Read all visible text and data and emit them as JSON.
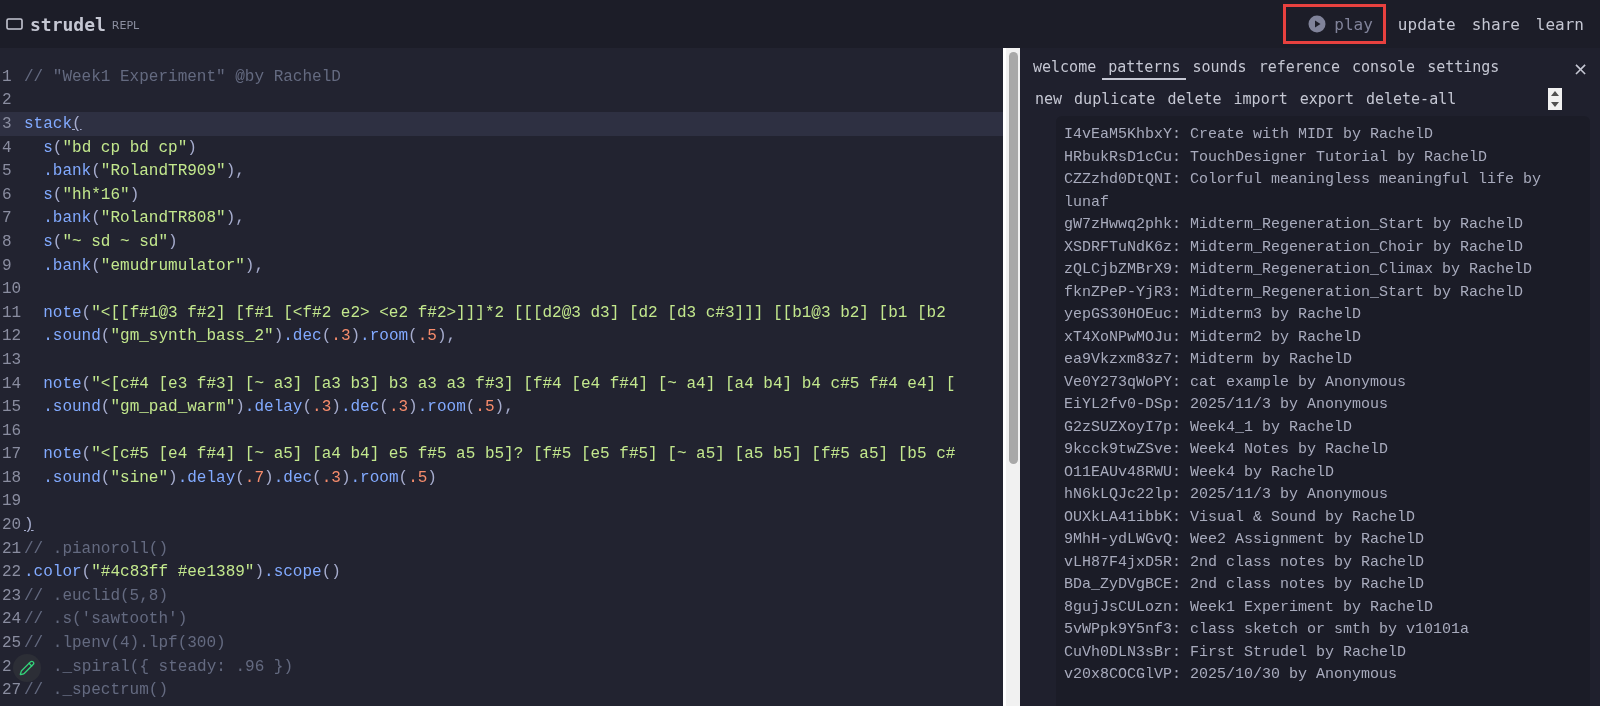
{
  "header": {
    "logo": "strudel",
    "subtitle": "REPL",
    "actions": [
      {
        "kind": "play",
        "label": "play",
        "highlighted": true
      },
      {
        "kind": "text",
        "label": "update",
        "highlighted": false
      },
      {
        "kind": "text",
        "label": "share",
        "highlighted": false
      },
      {
        "kind": "text",
        "label": "learn",
        "highlighted": false
      }
    ]
  },
  "editor": {
    "lines": [
      {
        "number": "1",
        "active": false,
        "tokens": [
          {
            "kind": "comment",
            "text": "// \"Week1 Experiment\" @by RachelD"
          }
        ]
      },
      {
        "number": "2",
        "active": false
      },
      {
        "number": "3",
        "active": true,
        "tokens": [
          {
            "kind": "func",
            "text": "stack"
          },
          {
            "kind": "match",
            "text": "("
          }
        ]
      },
      {
        "number": "4",
        "active": false,
        "tokens": [
          {
            "kind": "func",
            "text": "  s"
          },
          {
            "kind": "punct",
            "text": "("
          },
          {
            "kind": "string",
            "text": "\"bd cp bd cp\""
          },
          {
            "kind": "punct",
            "text": ")"
          }
        ]
      },
      {
        "number": "5",
        "active": false,
        "tokens": [
          {
            "kind": "func",
            "text": "  .bank"
          },
          {
            "kind": "punct",
            "text": "("
          },
          {
            "kind": "string",
            "text": "\"RolandTR909\""
          },
          {
            "kind": "punct",
            "text": "),"
          }
        ]
      },
      {
        "number": "6",
        "active": false,
        "tokens": [
          {
            "kind": "func",
            "text": "  s"
          },
          {
            "kind": "punct",
            "text": "("
          },
          {
            "kind": "string",
            "text": "\"hh*16\""
          },
          {
            "kind": "punct",
            "text": ")"
          }
        ]
      },
      {
        "number": "7",
        "active": false,
        "tokens": [
          {
            "kind": "func",
            "text": "  .bank"
          },
          {
            "kind": "punct",
            "text": "("
          },
          {
            "kind": "string",
            "text": "\"RolandTR808\""
          },
          {
            "kind": "punct",
            "text": "),"
          }
        ]
      },
      {
        "number": "8",
        "active": false,
        "tokens": [
          {
            "kind": "func",
            "text": "  s"
          },
          {
            "kind": "punct",
            "text": "("
          },
          {
            "kind": "string",
            "text": "\"~ sd ~ sd\""
          },
          {
            "kind": "punct",
            "text": ")"
          }
        ]
      },
      {
        "number": "9",
        "active": false,
        "tokens": [
          {
            "kind": "func",
            "text": "  .bank"
          },
          {
            "kind": "punct",
            "text": "("
          },
          {
            "kind": "string",
            "text": "\"emudrumulator\""
          },
          {
            "kind": "punct",
            "text": "),"
          }
        ]
      },
      {
        "number": "10",
        "active": false
      },
      {
        "number": "11",
        "active": false,
        "tokens": [
          {
            "kind": "func",
            "text": "  note"
          },
          {
            "kind": "punct",
            "text": "("
          },
          {
            "kind": "string",
            "text": "\"<[[f#1@3 f#2] [f#1 [<f#2 e2> <e2 f#2>]]]*2 [[[d2@3 d3] [d2 [d3 c#3]]] [[b1@3 b2] [b1 [b2"
          }
        ]
      },
      {
        "number": "12",
        "active": false,
        "tokens": [
          {
            "kind": "func",
            "text": "  .sound"
          },
          {
            "kind": "punct",
            "text": "("
          },
          {
            "kind": "string",
            "text": "\"gm_synth_bass_2\""
          },
          {
            "kind": "punct",
            "text": ")"
          },
          {
            "kind": "func",
            "text": ".dec"
          },
          {
            "kind": "punct",
            "text": "("
          },
          {
            "kind": "number",
            "text": ".3"
          },
          {
            "kind": "punct",
            "text": ")"
          },
          {
            "kind": "func",
            "text": ".room"
          },
          {
            "kind": "punct",
            "text": "("
          },
          {
            "kind": "number",
            "text": ".5"
          },
          {
            "kind": "punct",
            "text": "),"
          }
        ]
      },
      {
        "number": "13",
        "active": false
      },
      {
        "number": "14",
        "active": false,
        "tokens": [
          {
            "kind": "func",
            "text": "  note"
          },
          {
            "kind": "punct",
            "text": "("
          },
          {
            "kind": "string",
            "text": "\"<[c#4 [e3 f#3] [~ a3] [a3 b3] b3 a3 a3 f#3] [f#4 [e4 f#4] [~ a4] [a4 b4] b4 c#5 f#4 e4] ["
          }
        ]
      },
      {
        "number": "15",
        "active": false,
        "tokens": [
          {
            "kind": "func",
            "text": "  .sound"
          },
          {
            "kind": "punct",
            "text": "("
          },
          {
            "kind": "string",
            "text": "\"gm_pad_warm\""
          },
          {
            "kind": "punct",
            "text": ")"
          },
          {
            "kind": "func",
            "text": ".delay"
          },
          {
            "kind": "punct",
            "text": "("
          },
          {
            "kind": "number",
            "text": ".3"
          },
          {
            "kind": "punct",
            "text": ")"
          },
          {
            "kind": "func",
            "text": ".dec"
          },
          {
            "kind": "punct",
            "text": "("
          },
          {
            "kind": "number",
            "text": ".3"
          },
          {
            "kind": "punct",
            "text": ")"
          },
          {
            "kind": "func",
            "text": ".room"
          },
          {
            "kind": "punct",
            "text": "("
          },
          {
            "kind": "number",
            "text": ".5"
          },
          {
            "kind": "punct",
            "text": "),"
          }
        ]
      },
      {
        "number": "16",
        "active": false
      },
      {
        "number": "17",
        "active": false,
        "tokens": [
          {
            "kind": "func",
            "text": "  note"
          },
          {
            "kind": "punct",
            "text": "("
          },
          {
            "kind": "string",
            "text": "\"<[c#5 [e4 f#4] [~ a5] [a4 b4] e5 f#5 a5 b5]? [f#5 [e5 f#5] [~ a5] [a5 b5] [f#5 a5] [b5 c#"
          }
        ]
      },
      {
        "number": "18",
        "active": false,
        "tokens": [
          {
            "kind": "func",
            "text": "  .sound"
          },
          {
            "kind": "punct",
            "text": "("
          },
          {
            "kind": "string",
            "text": "\"sine\""
          },
          {
            "kind": "punct",
            "text": ")"
          },
          {
            "kind": "func",
            "text": ".delay"
          },
          {
            "kind": "punct",
            "text": "("
          },
          {
            "kind": "number",
            "text": ".7"
          },
          {
            "kind": "punct",
            "text": ")"
          },
          {
            "kind": "func",
            "text": ".dec"
          },
          {
            "kind": "punct",
            "text": "("
          },
          {
            "kind": "number",
            "text": ".3"
          },
          {
            "kind": "punct",
            "text": ")"
          },
          {
            "kind": "func",
            "text": ".room"
          },
          {
            "kind": "punct",
            "text": "("
          },
          {
            "kind": "number",
            "text": ".5"
          },
          {
            "kind": "punct",
            "text": ")"
          }
        ]
      },
      {
        "number": "19",
        "active": false
      },
      {
        "number": "20",
        "active": false,
        "tokens": [
          {
            "kind": "match",
            "text": ")"
          }
        ]
      },
      {
        "number": "21",
        "active": false,
        "tokens": [
          {
            "kind": "comment",
            "text": "// .pianoroll()"
          }
        ]
      },
      {
        "number": "22",
        "active": false,
        "tokens": [
          {
            "kind": "func",
            "text": ".color"
          },
          {
            "kind": "punct",
            "text": "("
          },
          {
            "kind": "string",
            "text": "\"#4c83ff #ee1389\""
          },
          {
            "kind": "punct",
            "text": ")"
          },
          {
            "kind": "func",
            "text": ".scope"
          },
          {
            "kind": "punct",
            "text": "()"
          }
        ]
      },
      {
        "number": "23",
        "active": false,
        "tokens": [
          {
            "kind": "comment",
            "text": "// .euclid(5,8)"
          }
        ]
      },
      {
        "number": "24",
        "active": false,
        "tokens": [
          {
            "kind": "comment",
            "text": "// .s('sawtooth')"
          }
        ]
      },
      {
        "number": "25",
        "active": false,
        "tokens": [
          {
            "kind": "comment",
            "text": "// .lpenv(4).lpf(300)"
          }
        ]
      },
      {
        "number": "2",
        "active": false,
        "covered": true,
        "tokens": [
          {
            "kind": "comment",
            "text": "._spiral({ steady: .96 })"
          }
        ]
      },
      {
        "number": "27",
        "active": false,
        "tokens": [
          {
            "kind": "comment",
            "text": "// ._spectrum()"
          }
        ]
      }
    ]
  },
  "panel": {
    "tabs": [
      {
        "label": "welcome",
        "selected": false
      },
      {
        "label": "patterns",
        "selected": true
      },
      {
        "label": "sounds",
        "selected": false
      },
      {
        "label": "reference",
        "selected": false
      },
      {
        "label": "console",
        "selected": false
      },
      {
        "label": "settings",
        "selected": false
      }
    ],
    "close": "×",
    "actions": [
      "new",
      "duplicate",
      "delete",
      "import",
      "export",
      "delete-all"
    ],
    "patterns": [
      {
        "id": "I4vEaM5KhbxY:",
        "title": "Create with MIDI by RachelD"
      },
      {
        "id": "HRbukRsD1cCu:",
        "title": "TouchDesigner Tutorial by RachelD"
      },
      {
        "id": "CZZzhd0DtQNI:",
        "title": "Colorful meaningless meaningful life by lunaf"
      },
      {
        "id": "gW7zHwwq2phk:",
        "title": "Midterm_Regeneration_Start by RachelD"
      },
      {
        "id": "XSDRFTuNdK6z:",
        "title": "Midterm_Regeneration_Choir by RachelD"
      },
      {
        "id": "zQLCjbZMBrX9:",
        "title": "Midterm_Regeneration_Climax by RachelD"
      },
      {
        "id": "fknZPeP-YjR3:",
        "title": "Midterm_Regeneration_Start by RachelD"
      },
      {
        "id": "yepGS30HOEuc:",
        "title": "Midterm3 by RachelD"
      },
      {
        "id": "xT4XoNPwMOJu:",
        "title": "Midterm2 by RachelD"
      },
      {
        "id": "ea9Vkzxm83z7:",
        "title": "Midterm by RachelD"
      },
      {
        "id": "Ve0Y273qWoPY:",
        "title": "cat example by Anonymous"
      },
      {
        "id": "EiYL2fv0-DSp:",
        "title": "2025/11/3 by Anonymous"
      },
      {
        "id": "G2zSUZXoyI7p:",
        "title": "Week4_1 by RachelD"
      },
      {
        "id": "9kcck9twZSve:",
        "title": "Week4 Notes by RachelD"
      },
      {
        "id": "O11EAUv48RWU:",
        "title": "Week4 by RachelD"
      },
      {
        "id": "hN6kLQJc22lp:",
        "title": "2025/11/3 by Anonymous"
      },
      {
        "id": "OUXkLA41ibbK:",
        "title": "Visual & Sound by RachelD"
      },
      {
        "id": "9MhH-ydLWGvQ:",
        "title": "Wee2 Assignment by RachelD"
      },
      {
        "id": "vLH87F4jxD5R:",
        "title": "2nd class notes by RachelD"
      },
      {
        "id": "BDa_ZyDVgBCE:",
        "title": "2nd class notes by RachelD"
      },
      {
        "id": "8gujJsCULozn:",
        "title": "Week1 Experiment by RachelD"
      },
      {
        "id": "5vWPpk9Y5nf3:",
        "title": "class sketch or smth by v10101a"
      },
      {
        "id": "CuVh0DLN3sBr:",
        "title": "First Strudel by RachelD"
      },
      {
        "id": "v20x8COCGlVP:",
        "title": "2025/10/30 by Anonymous"
      }
    ]
  }
}
